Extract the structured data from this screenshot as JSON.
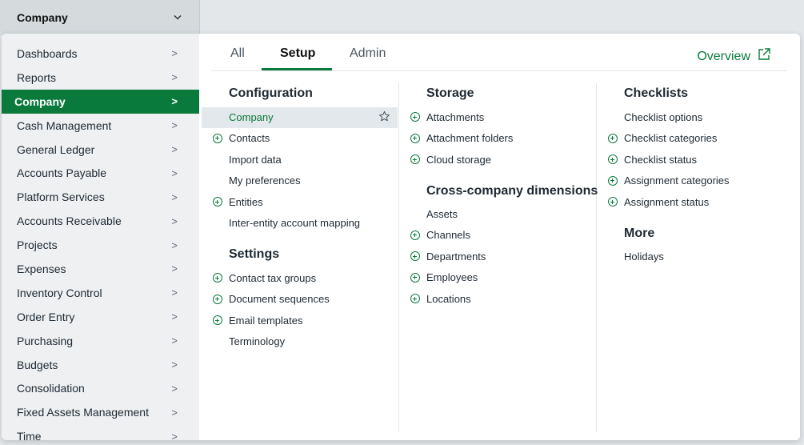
{
  "topbar": {
    "company_label": "Company",
    "chevron": "chevron-down-icon"
  },
  "sidebar": {
    "items": [
      {
        "label": "Dashboards"
      },
      {
        "label": "Reports"
      },
      {
        "label": "Company",
        "active": true
      },
      {
        "label": "Cash Management"
      },
      {
        "label": "General Ledger"
      },
      {
        "label": "Accounts Payable"
      },
      {
        "label": "Platform Services"
      },
      {
        "label": "Accounts Receivable"
      },
      {
        "label": "Projects"
      },
      {
        "label": "Expenses"
      },
      {
        "label": "Inventory Control"
      },
      {
        "label": "Order Entry"
      },
      {
        "label": "Purchasing"
      },
      {
        "label": "Budgets"
      },
      {
        "label": "Consolidation"
      },
      {
        "label": "Fixed Assets Management"
      },
      {
        "label": "Time"
      }
    ],
    "arrow": ">"
  },
  "tabs": {
    "all": "All",
    "setup": "Setup",
    "admin": "Admin",
    "active": "Setup"
  },
  "overview": {
    "label": "Overview",
    "icon": "external-link-icon"
  },
  "columns": {
    "configuration": {
      "heading": "Configuration",
      "items": [
        {
          "label": "Company",
          "plus": false,
          "highlighted": true,
          "star": true
        },
        {
          "label": "Contacts",
          "plus": true
        },
        {
          "label": "Import data",
          "plus": false
        },
        {
          "label": "My preferences",
          "plus": false
        },
        {
          "label": "Entities",
          "plus": true
        },
        {
          "label": "Inter-entity account mapping",
          "plus": false
        }
      ]
    },
    "settings": {
      "heading": "Settings",
      "items": [
        {
          "label": "Contact tax groups",
          "plus": true
        },
        {
          "label": "Document sequences",
          "plus": true
        },
        {
          "label": "Email templates",
          "plus": true
        },
        {
          "label": "Terminology",
          "plus": false
        }
      ]
    },
    "storage": {
      "heading": "Storage",
      "items": [
        {
          "label": "Attachments",
          "plus": true
        },
        {
          "label": "Attachment folders",
          "plus": true
        },
        {
          "label": "Cloud storage",
          "plus": true
        }
      ]
    },
    "cross_company": {
      "heading": "Cross-company dimensions",
      "items": [
        {
          "label": "Assets",
          "plus": false
        },
        {
          "label": "Channels",
          "plus": true
        },
        {
          "label": "Departments",
          "plus": true
        },
        {
          "label": "Employees",
          "plus": true
        },
        {
          "label": "Locations",
          "plus": true
        }
      ]
    },
    "checklists": {
      "heading": "Checklists",
      "items": [
        {
          "label": "Checklist options",
          "plus": false
        },
        {
          "label": "Checklist categories",
          "plus": true
        },
        {
          "label": "Checklist status",
          "plus": true
        },
        {
          "label": "Assignment categories",
          "plus": true
        },
        {
          "label": "Assignment status",
          "plus": true
        }
      ]
    },
    "more": {
      "heading": "More",
      "items": [
        {
          "label": "Holidays",
          "plus": false
        }
      ]
    }
  },
  "colors": {
    "accent": "#0a7a3c",
    "sidebar_bg": "#eef0f2",
    "highlight": "#e2e8eb"
  }
}
